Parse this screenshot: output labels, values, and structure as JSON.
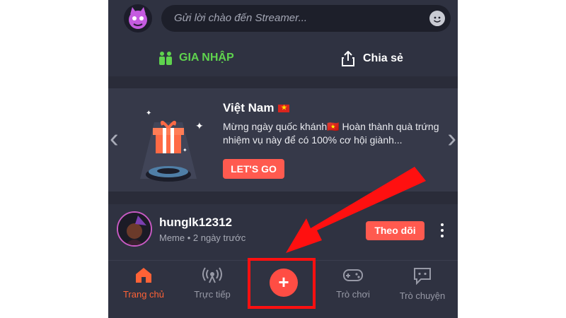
{
  "top": {
    "chat_placeholder": "Gửi lời chào đến Streamer...",
    "emoji_icon": "smiley-icon"
  },
  "actions": {
    "join_label": "GIA NHẬP",
    "share_label": "Chia sẻ"
  },
  "banner": {
    "title": "Việt Nam",
    "text": "Mừng ngày quốc khánh🇻🇳 Hoàn thành quà trứng nhiệm vụ này để có 100% cơ hội giành...",
    "button_label": "LET'S GO"
  },
  "post": {
    "username": "hunglk12312",
    "meta": "Meme • 2 ngày trước",
    "follow_label": "Theo dõi"
  },
  "tabs": [
    {
      "label": "Trang chủ",
      "icon": "home-icon",
      "active": true
    },
    {
      "label": "Trực tiếp",
      "icon": "live-broadcast-icon",
      "active": false
    },
    {
      "label": "",
      "icon": "plus-icon",
      "active": false
    },
    {
      "label": "Trò chơi",
      "icon": "gamepad-icon",
      "active": false
    },
    {
      "label": "Trò chuyện",
      "icon": "chat-bubble-icon",
      "active": false
    }
  ],
  "colors": {
    "accent": "#ff5a4f",
    "join_green": "#5fd34e",
    "annotation_red": "#ff1010",
    "background": "#2f3241"
  }
}
